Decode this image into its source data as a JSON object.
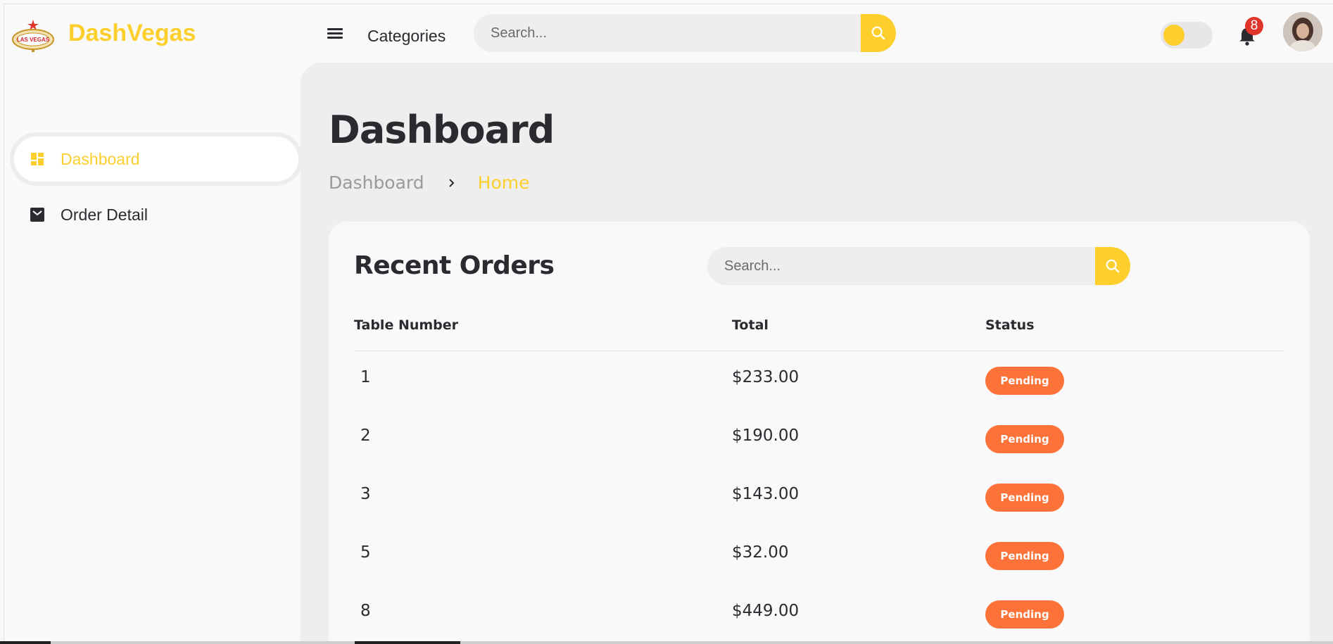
{
  "brand": {
    "name": "DashVegas",
    "logo_text": "LAS VEGAS",
    "accent": "#fccf2c"
  },
  "topbar": {
    "menu_icon": "hamburger-icon",
    "categories_label": "Categories",
    "search_placeholder": "Search...",
    "notification_count": "8"
  },
  "sidebar": {
    "items": [
      {
        "label": "Dashboard",
        "icon": "dashboard-grid-icon",
        "active": true
      },
      {
        "label": "Order Detail",
        "icon": "envelope-box-icon",
        "active": false
      }
    ]
  },
  "main": {
    "title": "Dashboard",
    "breadcrumb": [
      "Dashboard",
      "Home"
    ]
  },
  "orders": {
    "title": "Recent Orders",
    "search_placeholder": "Search...",
    "columns": [
      "Table Number",
      "Total",
      "Status"
    ],
    "rows": [
      {
        "table": "1",
        "total": "$233.00",
        "status": "Pending"
      },
      {
        "table": "2",
        "total": "$190.00",
        "status": "Pending"
      },
      {
        "table": "3",
        "total": "$143.00",
        "status": "Pending"
      },
      {
        "table": "5",
        "total": "$32.00",
        "status": "Pending"
      },
      {
        "table": "8",
        "total": "$449.00",
        "status": "Pending"
      }
    ],
    "status_color": "#fd7238"
  }
}
